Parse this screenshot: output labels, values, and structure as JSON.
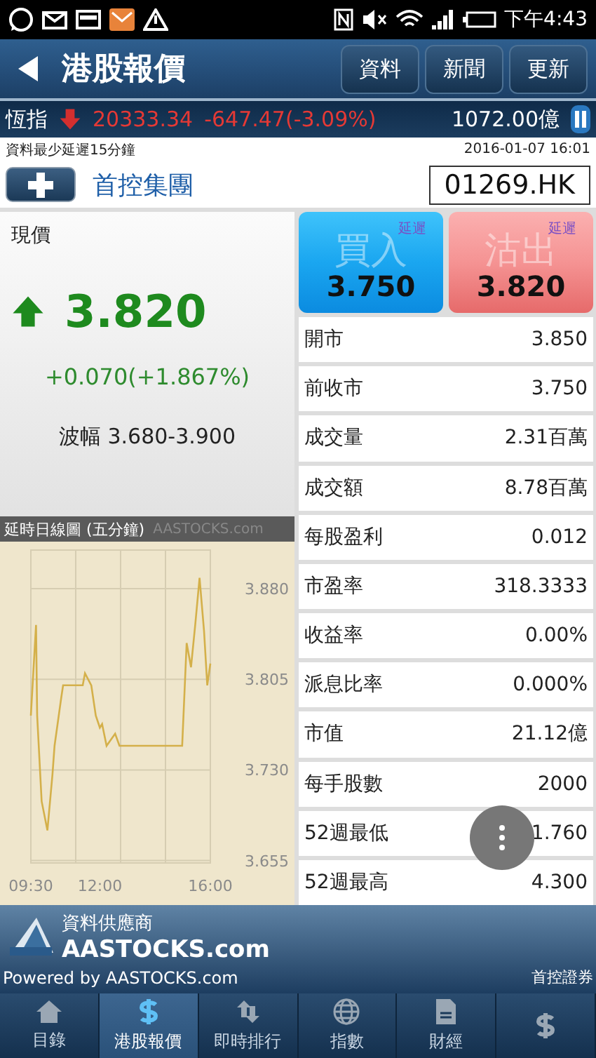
{
  "status_bar": {
    "time": "下午4:43"
  },
  "header": {
    "title": "港股報價",
    "buttons": [
      "資料",
      "新聞",
      "更新"
    ]
  },
  "ticker": {
    "name": "恆指",
    "value": "20333.34",
    "change": "-647.47(-3.09%)",
    "turnover": "1072.00億"
  },
  "notice": "資料最少延遲15分鐘",
  "timestamp": "2016-01-07 16:01",
  "stock": {
    "name": "首控集團",
    "code": "01269.HK"
  },
  "quote": {
    "label": "現價",
    "price": "3.820",
    "change": "+0.070(+1.867%)",
    "range": "波幅 3.680-3.900"
  },
  "orders": [
    {
      "kind": "buy",
      "label": "買入",
      "tag": "延遲",
      "price": "3.750"
    },
    {
      "kind": "sell",
      "label": "沽出",
      "tag": "延遲",
      "price": "3.820"
    }
  ],
  "stats": [
    {
      "label": "開市",
      "value": "3.850"
    },
    {
      "label": "前收市",
      "value": "3.750"
    },
    {
      "label": "成交量",
      "value": "2.31百萬"
    },
    {
      "label": "成交額",
      "value": "8.78百萬"
    },
    {
      "label": "每股盈利",
      "value": "0.012"
    },
    {
      "label": "市盈率",
      "value": "318.3333"
    },
    {
      "label": "收益率",
      "value": "0.00%"
    },
    {
      "label": "派息比率",
      "value": "0.000%"
    },
    {
      "label": "市值",
      "value": "21.12億"
    },
    {
      "label": "每手股數",
      "value": "2000"
    },
    {
      "label": "52週最低",
      "value": "1.760"
    },
    {
      "label": "52週最高",
      "value": "4.300"
    }
  ],
  "chart": {
    "credit": "AASTOCKS.com",
    "chart_data": {
      "type": "line",
      "title": "延時日線圖 (五分鐘)",
      "x": [
        9.5,
        9.69,
        9.73,
        9.89,
        10.1,
        10.28,
        10.36,
        10.6,
        10.67,
        11.38,
        11.46,
        11.69,
        11.85,
        12.0,
        12.08,
        12.24,
        12.55,
        12.71,
        14.98,
        15.14,
        15.3,
        15.45,
        15.61,
        15.77,
        15.89,
        16.0
      ],
      "series": [
        {
          "color": "#d4b04a",
          "values": [
            3.775,
            3.85,
            3.775,
            3.704,
            3.68,
            3.726,
            3.75,
            3.79,
            3.8,
            3.8,
            3.81,
            3.8,
            3.775,
            3.765,
            3.768,
            3.75,
            3.76,
            3.75,
            3.75,
            3.835,
            3.815,
            3.85,
            3.889,
            3.845,
            3.8,
            3.818
          ]
        }
      ],
      "xlim": [
        9.5,
        16
      ],
      "ylim": [
        3.653,
        3.912
      ],
      "xticks": [
        {
          "value": 9.5,
          "label": "09:30"
        },
        {
          "value": 12,
          "label": "12:00"
        },
        {
          "value": 16,
          "label": "16:00"
        }
      ],
      "yticks": [
        {
          "value": 3.655,
          "label": "3.655"
        },
        {
          "value": 3.73,
          "label": "3.730"
        },
        {
          "value": 3.805,
          "label": "3.805"
        },
        {
          "value": 3.88,
          "label": "3.880"
        }
      ],
      "grid": true
    }
  },
  "footer": {
    "provider_label": "資料供應商",
    "provider": "AASTOCKS.com",
    "powered": "Powered by AASTOCKS.com",
    "broker": "首控證券"
  },
  "nav": [
    {
      "kind": "home",
      "label": "目錄",
      "selected": false
    },
    {
      "kind": "dollar",
      "label": "港股報價",
      "selected": true
    },
    {
      "kind": "arrows",
      "label": "即時排行",
      "selected": false
    },
    {
      "kind": "globe",
      "label": "指數",
      "selected": false
    },
    {
      "kind": "document",
      "label": "財經",
      "selected": false
    },
    {
      "kind": "dollar",
      "selected": false
    }
  ]
}
